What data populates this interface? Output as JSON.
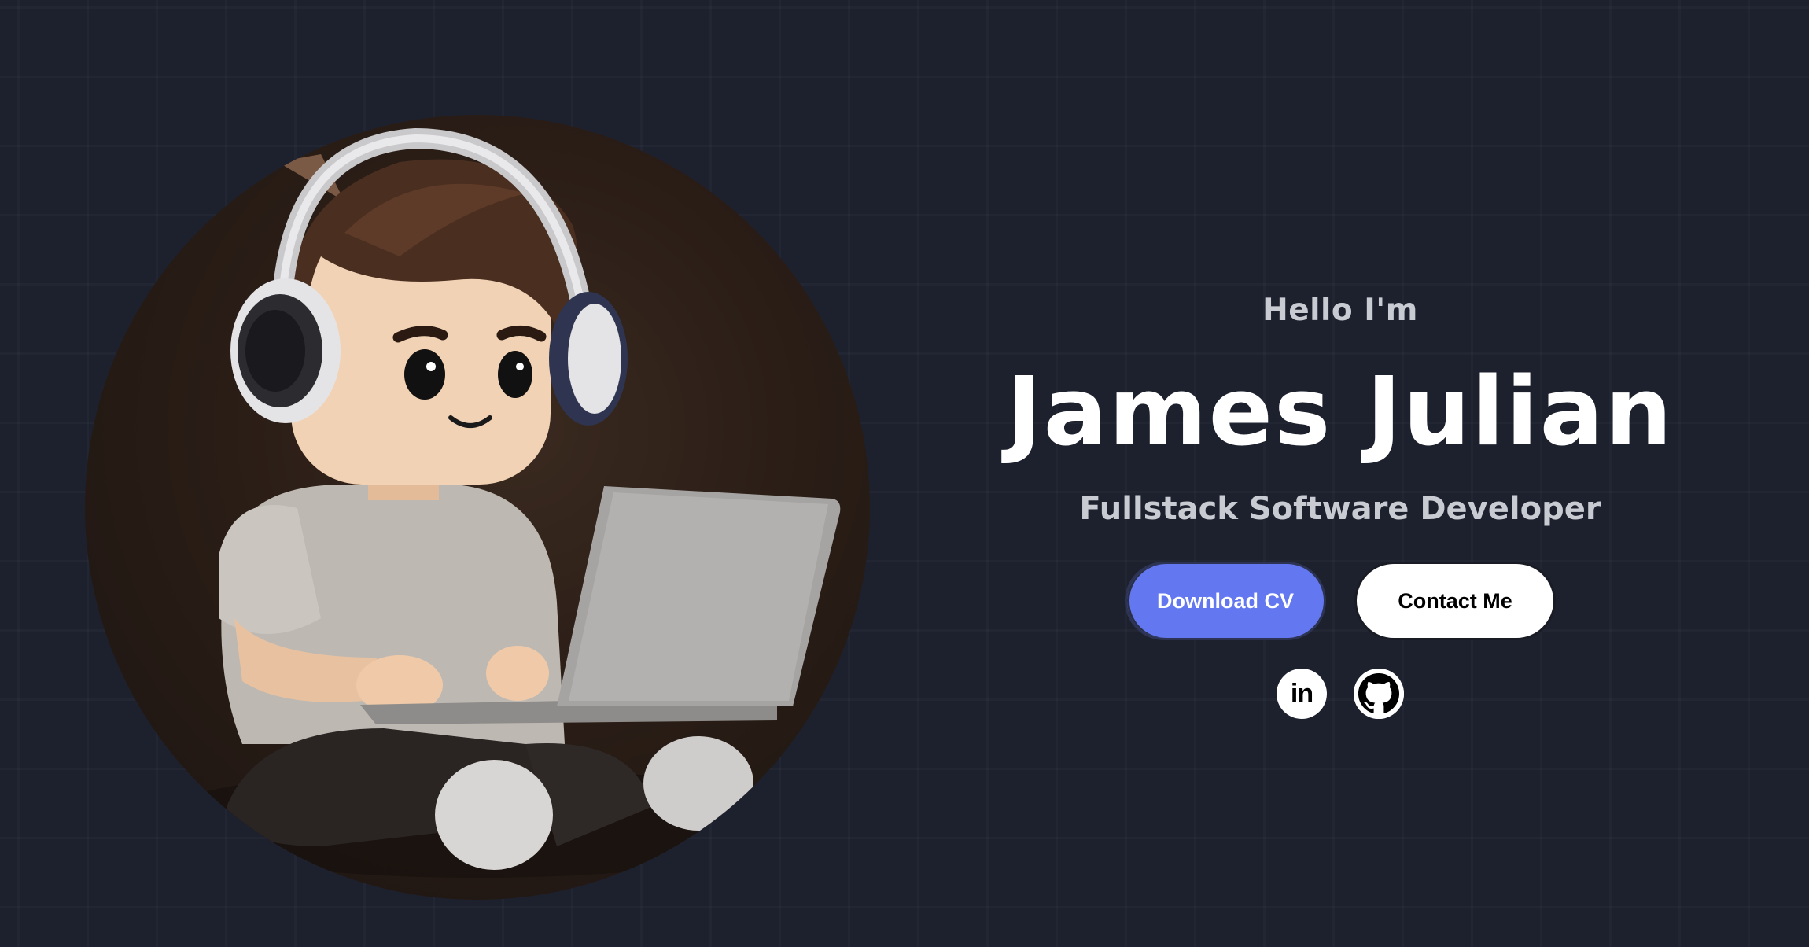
{
  "hero": {
    "greeting": "Hello I'm",
    "name": "James Julian",
    "role": "Fullstack Software Developer"
  },
  "buttons": {
    "download_label": "Download CV",
    "contact_label": "Contact Me"
  },
  "socials": [
    {
      "icon": "linkedin-icon",
      "text": "in"
    },
    {
      "icon": "github-icon"
    }
  ],
  "colors": {
    "background": "#1d202d",
    "accent": "#6377f0",
    "text_primary": "#ffffff",
    "text_secondary": "#c9cbd2"
  }
}
